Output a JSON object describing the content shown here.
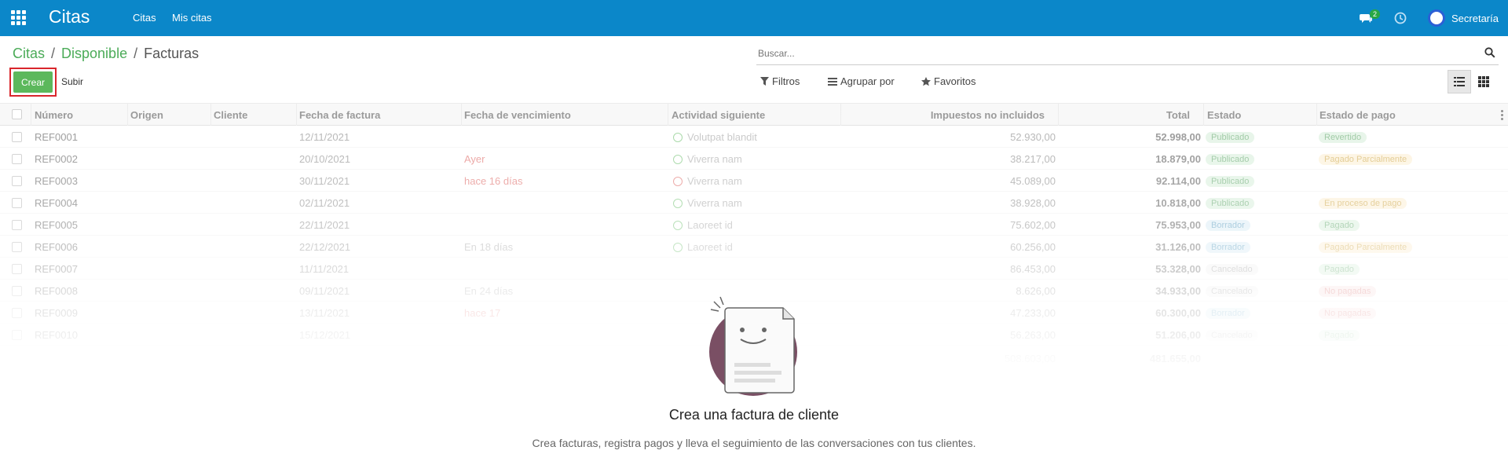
{
  "navbar": {
    "app_title": "Citas",
    "menu": [
      "Citas",
      "Mis citas"
    ],
    "chat_count": "2",
    "user": "Secretaría"
  },
  "breadcrumb": [
    "Citas",
    "Disponible",
    "Facturas"
  ],
  "actions": {
    "create": "Crear",
    "upload": "Subir"
  },
  "search": {
    "placeholder": "Buscar..."
  },
  "filters": {
    "filters": "Filtros",
    "group_by": "Agrupar por",
    "favorites": "Favoritos"
  },
  "table": {
    "headers": {
      "number": "Número",
      "origin": "Origen",
      "client": "Cliente",
      "invoice_date": "Fecha de factura",
      "due_date": "Fecha de vencimiento",
      "next_activity": "Actividad siguiente",
      "untaxed": "Impuestos no incluidos",
      "total": "Total",
      "state": "Estado",
      "payment_state": "Estado de pago"
    },
    "rows": [
      {
        "number": "REF0001",
        "date": "12/11/2021",
        "due": "",
        "activity": "Volutpat blandit",
        "untaxed": "52.930,00",
        "total": "52.998,00",
        "state": "Publicado",
        "payment": "Revertido"
      },
      {
        "number": "REF0002",
        "date": "20/10/2021",
        "due": "Ayer",
        "activity": "Viverra nam",
        "untaxed": "38.217,00",
        "total": "18.879,00",
        "state": "Publicado",
        "payment": "Pagado Parcialmente"
      },
      {
        "number": "REF0003",
        "date": "30/11/2021",
        "due": "hace 16 días",
        "activity": "Viverra nam",
        "untaxed": "45.089,00",
        "total": "92.114,00",
        "state": "Publicado",
        "payment": ""
      },
      {
        "number": "REF0004",
        "date": "02/11/2021",
        "due": "",
        "activity": "Viverra nam",
        "untaxed": "38.928,00",
        "total": "10.818,00",
        "state": "Publicado",
        "payment": "En proceso de pago"
      },
      {
        "number": "REF0005",
        "date": "22/11/2021",
        "due": "",
        "activity": "Laoreet id",
        "untaxed": "75.602,00",
        "total": "75.953,00",
        "state": "Borrador",
        "payment": "Pagado"
      },
      {
        "number": "REF0006",
        "date": "22/12/2021",
        "due": "En 18 días",
        "activity": "Laoreet id",
        "untaxed": "60.256,00",
        "total": "31.126,00",
        "state": "Borrador",
        "payment": "Pagado Parcialmente"
      },
      {
        "number": "REF0007",
        "date": "11/11/2021",
        "due": "",
        "activity": "",
        "untaxed": "86.453,00",
        "total": "53.328,00",
        "state": "Cancelado",
        "payment": "Pagado"
      },
      {
        "number": "REF0008",
        "date": "09/11/2021",
        "due": "En 24 días",
        "activity": "",
        "untaxed": "8.626,00",
        "total": "34.933,00",
        "state": "Cancelado",
        "payment": "No pagadas"
      },
      {
        "number": "REF0009",
        "date": "13/11/2021",
        "due": "hace 17",
        "activity": "",
        "untaxed": "47.233,00",
        "total": "60.300,00",
        "state": "Borrador",
        "payment": "No pagadas"
      },
      {
        "number": "REF0010",
        "date": "15/12/2021",
        "due": "",
        "activity": "",
        "untaxed": "56.263,00",
        "total": "51.206,00",
        "state": "Cancelado",
        "payment": "Pagado"
      }
    ],
    "footer": {
      "untaxed_sum": "508.603,00",
      "total_sum": "481.655,00"
    }
  },
  "help": {
    "title": "Crea una factura de cliente",
    "text": "Crea facturas, registra pagos y lleva el seguimiento de las conversaciones con tus clientes."
  },
  "colors": {
    "navbar": "#0b87c9",
    "accent": "#4bab58",
    "create_button": "#5cb85c",
    "highlight_frame": "#d9262c"
  }
}
